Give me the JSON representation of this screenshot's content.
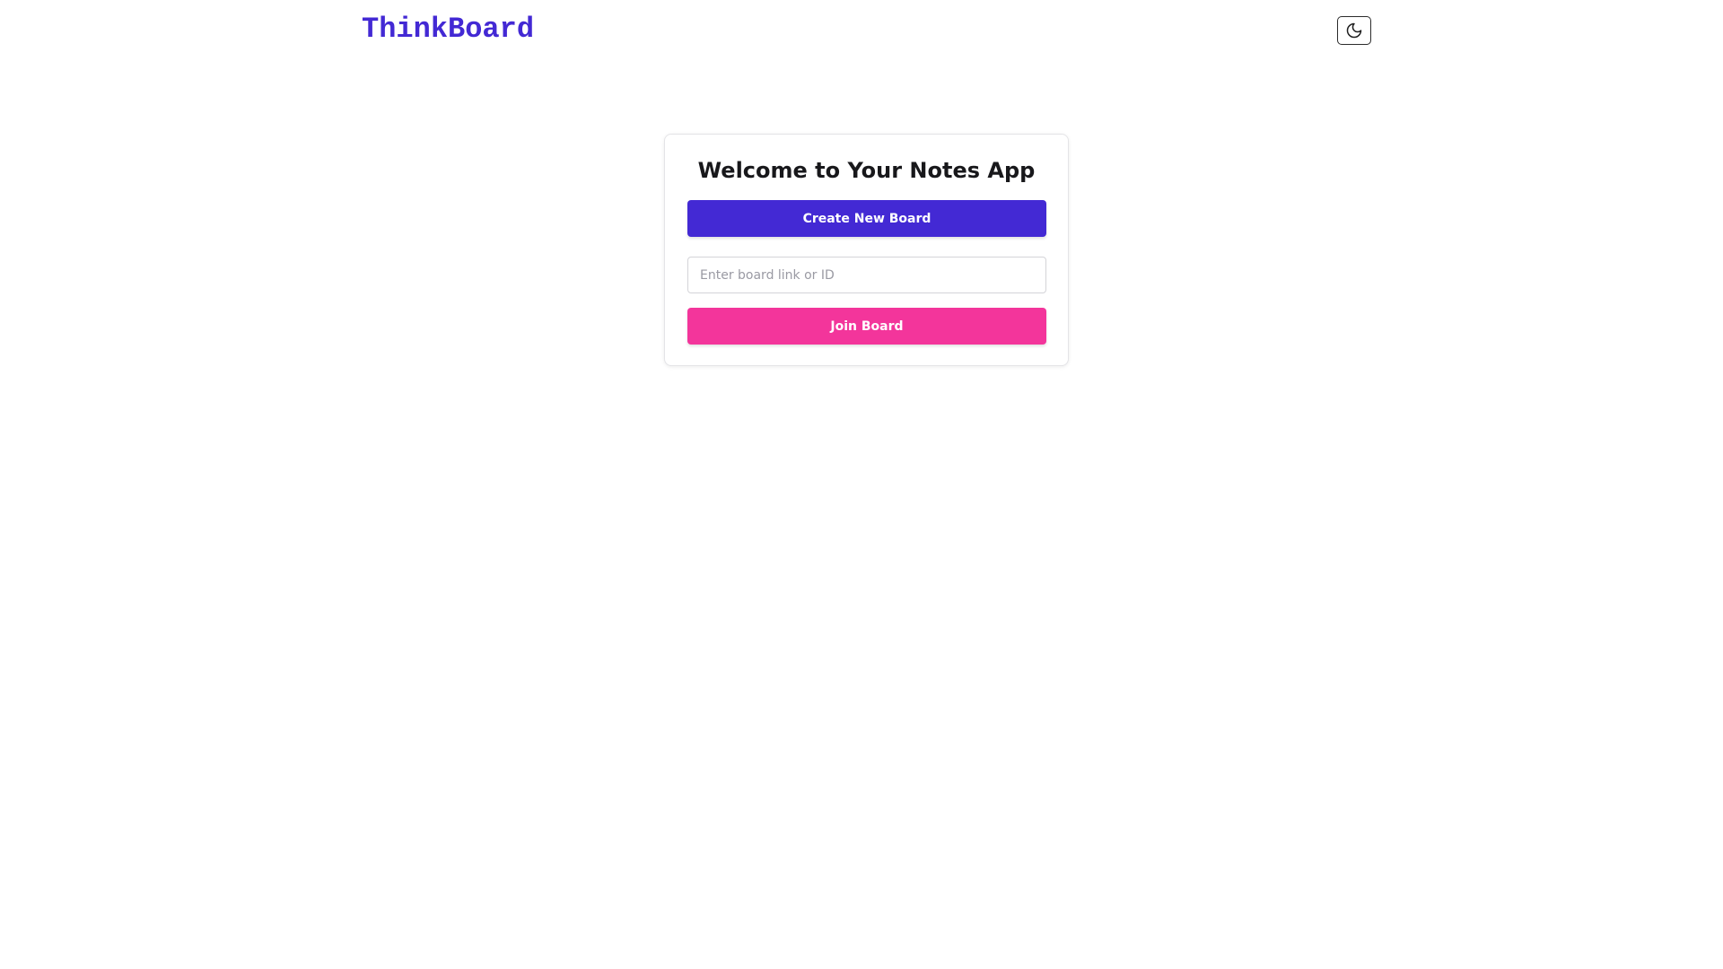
{
  "header": {
    "brand": "ThinkBoard",
    "theme_toggle_icon": "moon-icon"
  },
  "card": {
    "title": "Welcome to Your Notes App",
    "create_button_label": "Create New Board",
    "board_input": {
      "placeholder": "Enter board link or ID",
      "value": ""
    },
    "join_button_label": "Join Board"
  },
  "colors": {
    "brand": "#4329d4",
    "primary_button": "#4329d4",
    "secondary_button": "#f3359b",
    "title_text": "#18181b"
  }
}
